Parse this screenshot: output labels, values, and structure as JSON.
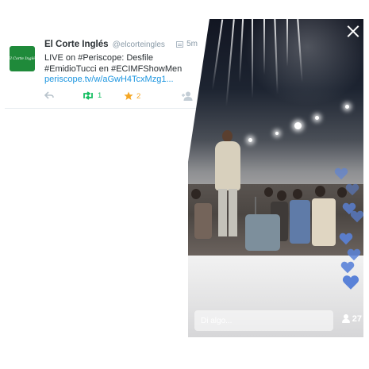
{
  "tweet": {
    "avatar_text": "El Corte Inglés",
    "name": "El Corte Inglés",
    "handle": "@elcorteingles",
    "time": "5m",
    "text_lines": [
      "LIVE on #Periscope: Desfile",
      "#EmidioTucci en #ECIMFShowMen"
    ],
    "link": "periscope.tv/w/aGwH4TcxMzg1...",
    "retweet_count": "1",
    "favorite_count": "2",
    "colors": {
      "retweet": "#17bf63",
      "favorite": "#f5a623",
      "link": "#1b95e0"
    }
  },
  "periscope": {
    "comment_placeholder": "Di algo...",
    "viewer_count": "27",
    "heart_color": "#5a82d8",
    "icons": [
      "close-icon",
      "viewer-icon",
      "heart-icon"
    ]
  }
}
